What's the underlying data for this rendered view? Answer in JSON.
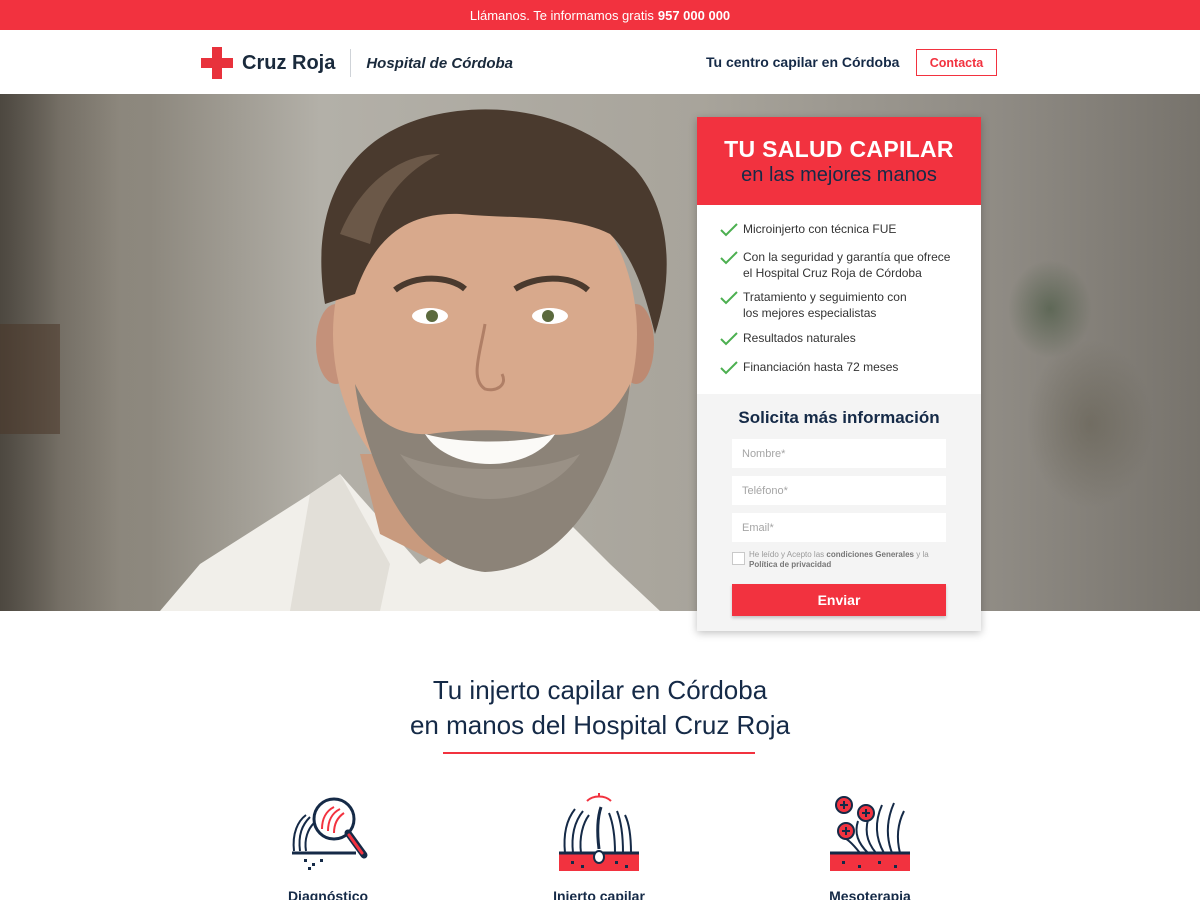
{
  "topbar": {
    "text": "Llámanos. Te informamos gratis",
    "phone": "957 000 000"
  },
  "header": {
    "brand": "Cruz Roja",
    "hospital": "Hospital de Córdoba",
    "tagline": "Tu centro capilar en Córdoba",
    "contact_label": "Contacta"
  },
  "panel": {
    "title": "TU SALUD CAPILAR",
    "subtitle": "en las mejores manos",
    "features": [
      "Microinjerto con técnica FUE",
      "Con la seguridad y garantía que ofrece el Hospital Cruz Roja de Córdoba",
      "Tratamiento y seguimiento con los mejores especialistas",
      "Resultados naturales",
      "Financiación hasta 72 meses"
    ]
  },
  "form": {
    "title": "Solicita más información",
    "name_placeholder": "Nombre*",
    "phone_placeholder": "Teléfono*",
    "email_placeholder": "Email*",
    "consent_prefix": "He leído y Acepto las",
    "consent_terms": "condiciones Generales",
    "consent_and": "y la",
    "consent_privacy": "Política de privacidad",
    "submit_label": "Enviar"
  },
  "section": {
    "title_line1": "Tu injerto capilar en Córdoba",
    "title_line2": "en manos del Hospital Cruz Roja"
  },
  "services": [
    {
      "label": "Diagnóstico",
      "icon": "magnifier-hair-icon"
    },
    {
      "label": "Injerto capilar",
      "icon": "hair-follicle-icon"
    },
    {
      "label": "Mesoterapia",
      "icon": "hair-treatment-icon"
    }
  ],
  "colors": {
    "accent": "#f2323f",
    "navy": "#152a47",
    "check": "#4caf50"
  }
}
